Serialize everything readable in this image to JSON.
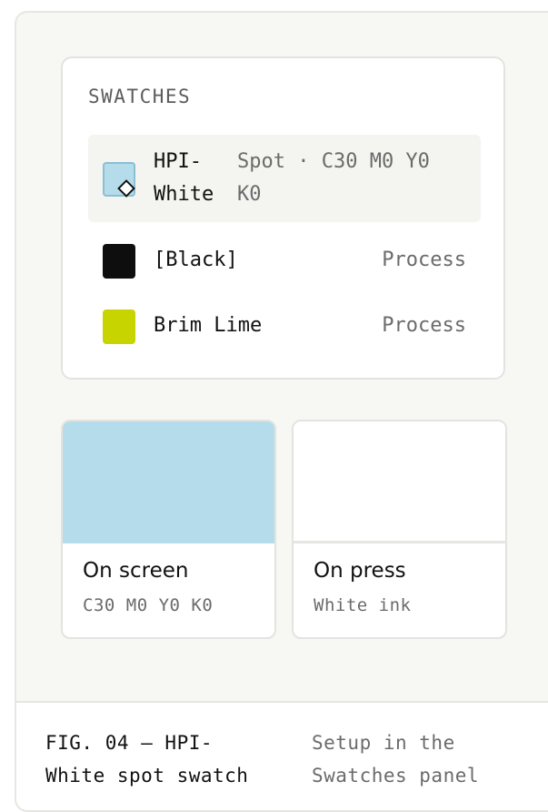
{
  "swatches_panel": {
    "title": "SWATCHES",
    "items": [
      {
        "name": "HPI-\nWhite",
        "type": "Spot · C30 M0 Y0 K0",
        "color": "#b5dcea",
        "selected": true,
        "icon": "spot-diamond-icon"
      },
      {
        "name": "[Black]",
        "type": "Process",
        "color": "#0e0e0e",
        "selected": false
      },
      {
        "name": "Brim Lime",
        "type": "Process",
        "color": "#c8d400",
        "selected": false
      }
    ]
  },
  "preview": {
    "screen": {
      "title": "On screen",
      "subtitle": "C30 M0 Y0 K0",
      "color": "#b5dcea"
    },
    "press": {
      "title": "On press",
      "subtitle": "White ink",
      "color": "#ffffff"
    }
  },
  "caption": {
    "title": "FIG. 04 — HPI-\nWhite spot swatch",
    "subtitle": "Setup in the\nSwatches panel"
  }
}
